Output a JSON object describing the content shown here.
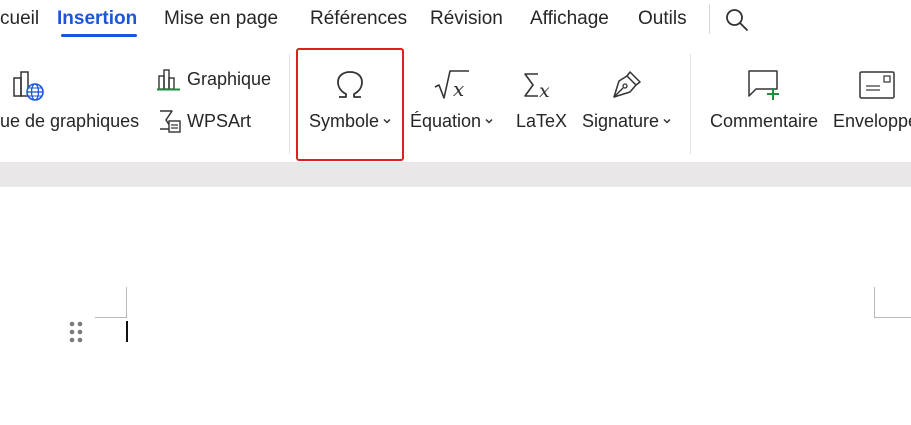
{
  "tabs": [
    {
      "id": "accueil",
      "label": "cueil",
      "active": false
    },
    {
      "id": "insertion",
      "label": "Insertion",
      "active": true
    },
    {
      "id": "mise-en-page",
      "label": "Mise en page",
      "active": false
    },
    {
      "id": "references",
      "label": "Références",
      "active": false
    },
    {
      "id": "revision",
      "label": "Révision",
      "active": false
    },
    {
      "id": "affichage",
      "label": "Affichage",
      "active": false
    },
    {
      "id": "outils",
      "label": "Outils",
      "active": false
    }
  ],
  "ribbon": {
    "chart_gallery_label": "ue de graphiques",
    "graphique_label": "Graphique",
    "wpsart_label": "WPSArt",
    "symbole_label": "Symbole",
    "equation_label": "Équation",
    "latex_label": "LaTeX",
    "signature_label": "Signature",
    "commentaire_label": "Commentaire",
    "enveloppe_label": "Enveloppe"
  },
  "icons": {
    "search": "search-icon",
    "chart_gallery": "chart-gallery-icon",
    "graphique": "bar-chart-icon",
    "wpsart": "wpsart-icon",
    "symbole": "omega-icon",
    "equation": "sqrt-x-icon",
    "latex": "sigma-x-icon",
    "signature": "pen-nib-icon",
    "commentaire": "comment-add-icon",
    "enveloppe": "envelope-icon"
  },
  "colors": {
    "accent": "#1a56db",
    "highlight": "#e02020",
    "comment_plus": "#1e8e3e"
  }
}
